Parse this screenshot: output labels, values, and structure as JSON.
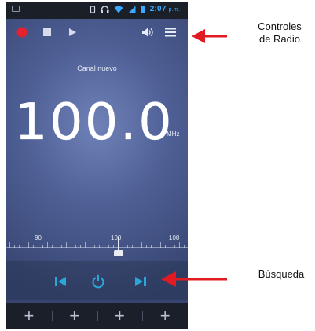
{
  "status_bar": {
    "time": "2:07",
    "ampm": "p.m."
  },
  "station": {
    "name": "Canal nuevo"
  },
  "frequency": {
    "value": "100.0",
    "unit": "MHz"
  },
  "dial": {
    "labels": [
      "90",
      "100",
      "108"
    ]
  },
  "presets": [
    {
      "label": "+"
    },
    {
      "label": "+"
    },
    {
      "label": "+"
    },
    {
      "label": "+"
    }
  ],
  "annotations": {
    "radio_controls": "Controles\nde Radio",
    "seek": "Búsqueda"
  },
  "colors": {
    "accent": "#2aa6d8",
    "record": "#e5222e",
    "arrow": "#e11b22"
  }
}
